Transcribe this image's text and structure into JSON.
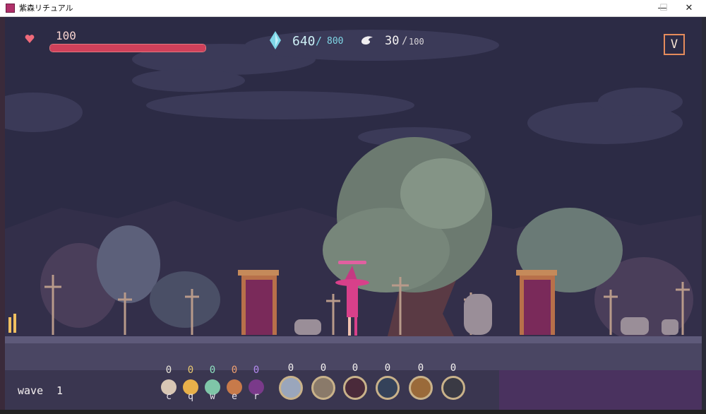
{
  "window": {
    "title": "紫森リチュアル",
    "minimize": "—",
    "maximize": "☐",
    "close": "✕"
  },
  "hud": {
    "hp_value": "100",
    "hp_fraction": 1.0,
    "heart_icon": "heart-icon",
    "crystal_current": "640",
    "crystal_sep": "/",
    "crystal_max": "800",
    "soul_current": "30",
    "soul_sep": "/",
    "soul_max": "100",
    "menu_button": "V"
  },
  "wave": {
    "label": "wave",
    "number": "1"
  },
  "items": [
    {
      "count": "0",
      "key": "c",
      "icon": "mushroom-icon",
      "color": "#d8c6b4"
    },
    {
      "count": "0",
      "key": "q",
      "icon": "fairy-icon",
      "color": "#e8b04a"
    },
    {
      "count": "0",
      "key": "w",
      "icon": "sprite-icon",
      "color": "#7fc6a8"
    },
    {
      "count": "0",
      "key": "e",
      "icon": "imp-icon",
      "color": "#c87a4a"
    },
    {
      "count": "0",
      "key": "r",
      "icon": "purple-mushroom-icon",
      "color": "#7a3a8a"
    }
  ],
  "units": [
    {
      "count": "0",
      "icon": "ghost-unit-icon",
      "color": "#9aa6bc"
    },
    {
      "count": "0",
      "icon": "knight-unit-icon",
      "color": "#8a7a6a"
    },
    {
      "count": "0",
      "icon": "bat-unit-icon",
      "color": "#4a2a3a"
    },
    {
      "count": "0",
      "icon": "slime-unit-icon",
      "color": "#34425a"
    },
    {
      "count": "0",
      "icon": "beast-unit-icon",
      "color": "#9a6a3a"
    },
    {
      "count": "0",
      "icon": "skull-unit-icon",
      "color": "#3a3a44"
    }
  ],
  "colors": {
    "sky": "#2c2b45",
    "ground": "#4a4663",
    "door": "#7a2a5a",
    "witch": "#d8408a"
  }
}
